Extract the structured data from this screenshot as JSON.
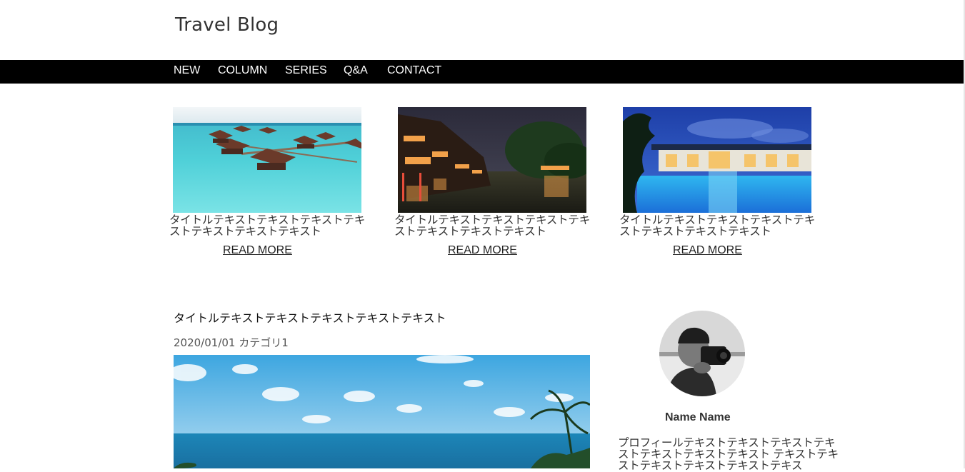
{
  "site": {
    "title": "Travel Blog"
  },
  "nav": [
    {
      "label": "NEW"
    },
    {
      "label": "COLUMN"
    },
    {
      "label": "SERIES"
    },
    {
      "label": "Q&A"
    },
    {
      "label": "CONTACT"
    }
  ],
  "featured": [
    {
      "title": "タイトルテキストテキストテキストテキストテキストテキストテキスト",
      "link": "READ MORE",
      "image": "overwater-villas-photo"
    },
    {
      "title": "タイトルテキストテキストテキストテキストテキストテキストテキスト",
      "link": "READ MORE",
      "image": "canal-town-night-photo"
    },
    {
      "title": "タイトルテキストテキストテキストテキストテキストテキストテキスト",
      "link": "READ MORE",
      "image": "resort-pool-night-photo"
    }
  ],
  "post": {
    "title": "タイトルテキストテキストテキストテキストテキスト",
    "meta": "2020/01/01 カテゴリ1",
    "image": "ocean-palms-photo"
  },
  "profile": {
    "name": "Name Name",
    "text": "プロフィールテキストテキストテキストテキストテキストテキストテキスト テキストテキストテキストテキストテキストテキス",
    "image": "photographer-avatar-photo"
  },
  "colors": {
    "nav_bg": "#000000",
    "nav_text": "#ffffff",
    "text": "#333333"
  }
}
